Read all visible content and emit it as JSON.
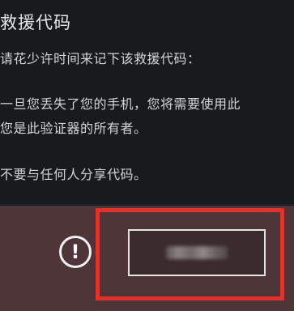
{
  "dialog": {
    "title": "救援代码",
    "lines": [
      "请花少许时间来记下该救援代码：",
      "一旦您丢失了您的手机，您将需要使用此",
      "您是此验证器的所有者。",
      "不要与任何人分享代码。"
    ]
  },
  "banner": {
    "icon": "exclamation-circle-icon",
    "colors": {
      "banner_bg": "#4d3538",
      "highlight": "#e3312b"
    }
  }
}
